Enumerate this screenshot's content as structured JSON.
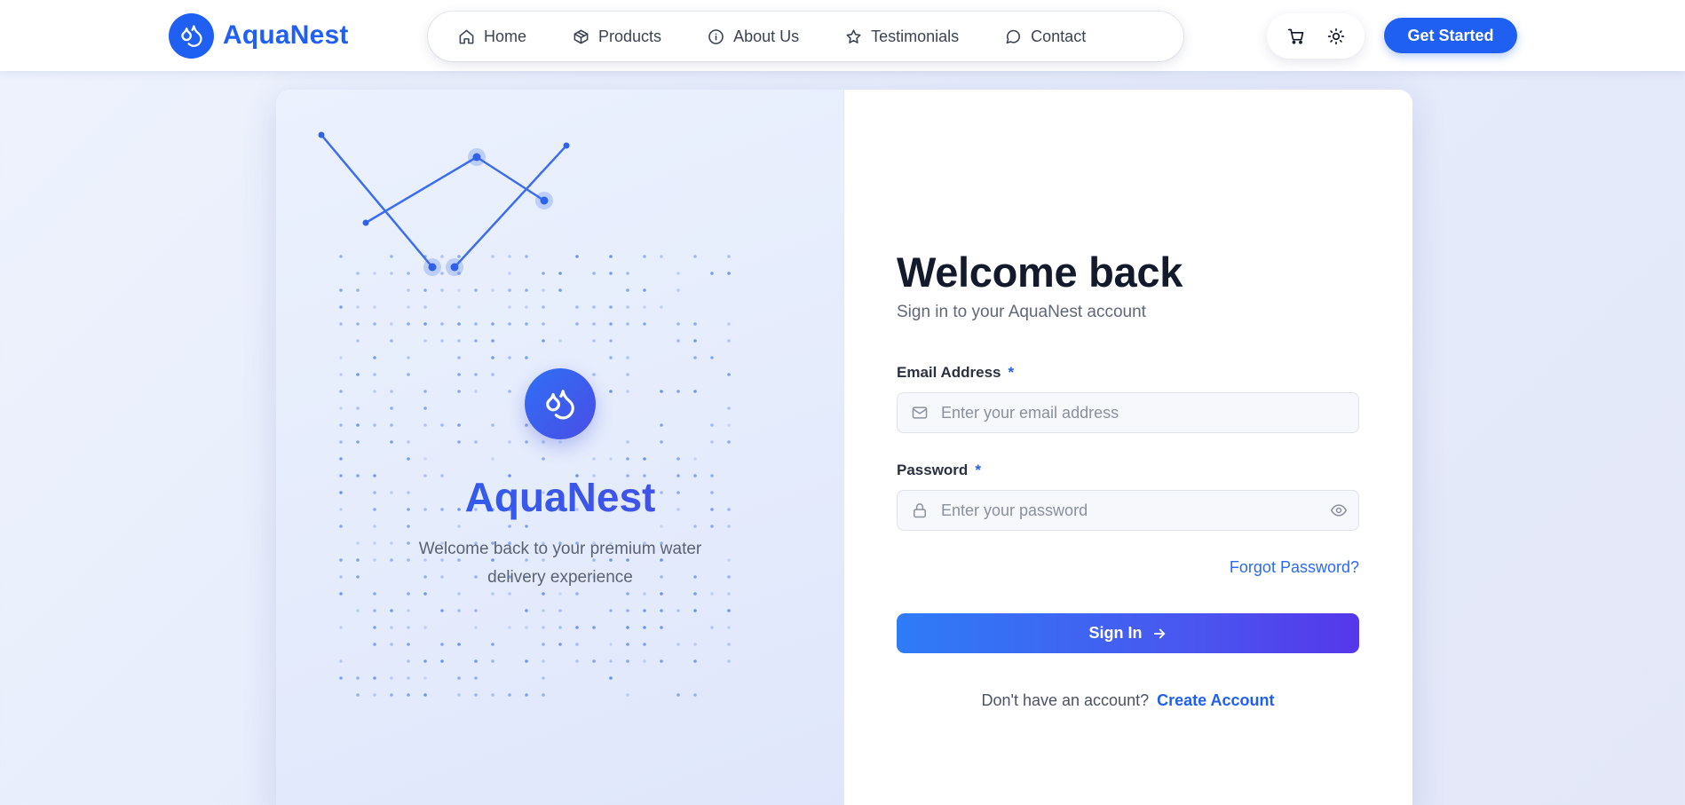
{
  "header": {
    "brand_name": "AquaNest",
    "nav": [
      {
        "label": "Home",
        "icon": "home-icon"
      },
      {
        "label": "Products",
        "icon": "box-icon"
      },
      {
        "label": "About Us",
        "icon": "info-icon"
      },
      {
        "label": "Testimonials",
        "icon": "star-icon"
      },
      {
        "label": "Contact",
        "icon": "chat-icon"
      }
    ],
    "cart_icon": "cart-icon",
    "theme_icon": "sun-icon",
    "cta_label": "Get Started"
  },
  "left_panel": {
    "title": "AquaNest",
    "subtitle": "Welcome back to your premium water delivery experience"
  },
  "form": {
    "title": "Welcome back",
    "subtitle": "Sign in to your AquaNest account",
    "email": {
      "label": "Email Address",
      "required_mark": "*",
      "placeholder": "Enter your email address",
      "value": ""
    },
    "password": {
      "label": "Password",
      "required_mark": "*",
      "placeholder": "Enter your password",
      "value": ""
    },
    "forgot_label": "Forgot Password?",
    "submit_label": "Sign In",
    "signup_prompt": "Don't have an account?",
    "signup_link": "Create Account"
  },
  "colors": {
    "brand": "#1f5ff2",
    "gradient_start": "#2e7cf6",
    "gradient_end": "#5637ea"
  }
}
